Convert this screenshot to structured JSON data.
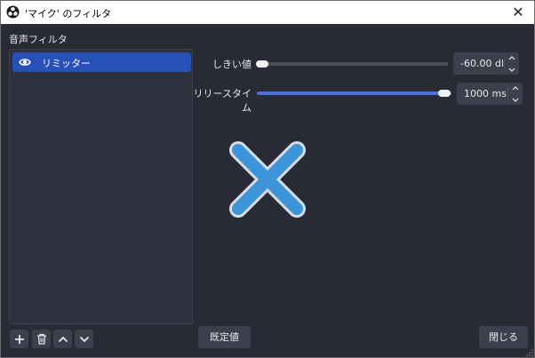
{
  "window": {
    "title": "'マイク' のフィルタ",
    "close_glyph": "✕"
  },
  "audio_filters": {
    "section_label": "音声フィルタ",
    "items": [
      {
        "label": "リミッター",
        "visible_icon": "eye-icon",
        "selected": true
      }
    ]
  },
  "toolbar": {
    "add_icon": "plus-icon",
    "remove_icon": "trash-icon",
    "move_up_icon": "chevron-up-icon",
    "move_down_icon": "chevron-down-icon"
  },
  "properties": {
    "threshold": {
      "label": "しきい値",
      "value_text": "-60.00 dB",
      "slider_fraction": 0.0
    },
    "release_time": {
      "label": "リリースタイム",
      "value_text": "1000 ms",
      "slider_fraction": 1.0
    }
  },
  "buttons": {
    "defaults_label": "既定値",
    "close_label": "閉じる"
  },
  "colors": {
    "accent": "#2850b9",
    "background": "#282a35",
    "list_bg": "#2d303d",
    "button_bg": "#3c404d",
    "slider_fill": "#4d71d9",
    "x_mark": "#3c95d8"
  }
}
